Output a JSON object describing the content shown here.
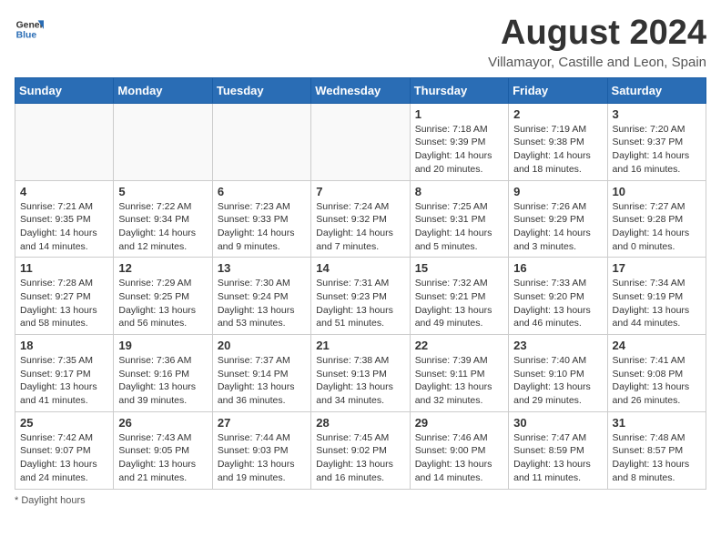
{
  "header": {
    "logo_line1": "General",
    "logo_line2": "Blue",
    "main_title": "August 2024",
    "subtitle": "Villamayor, Castille and Leon, Spain"
  },
  "days_of_week": [
    "Sunday",
    "Monday",
    "Tuesday",
    "Wednesday",
    "Thursday",
    "Friday",
    "Saturday"
  ],
  "weeks": [
    [
      {
        "day": "",
        "info": ""
      },
      {
        "day": "",
        "info": ""
      },
      {
        "day": "",
        "info": ""
      },
      {
        "day": "",
        "info": ""
      },
      {
        "day": "1",
        "info": "Sunrise: 7:18 AM\nSunset: 9:39 PM\nDaylight: 14 hours and 20 minutes."
      },
      {
        "day": "2",
        "info": "Sunrise: 7:19 AM\nSunset: 9:38 PM\nDaylight: 14 hours and 18 minutes."
      },
      {
        "day": "3",
        "info": "Sunrise: 7:20 AM\nSunset: 9:37 PM\nDaylight: 14 hours and 16 minutes."
      }
    ],
    [
      {
        "day": "4",
        "info": "Sunrise: 7:21 AM\nSunset: 9:35 PM\nDaylight: 14 hours and 14 minutes."
      },
      {
        "day": "5",
        "info": "Sunrise: 7:22 AM\nSunset: 9:34 PM\nDaylight: 14 hours and 12 minutes."
      },
      {
        "day": "6",
        "info": "Sunrise: 7:23 AM\nSunset: 9:33 PM\nDaylight: 14 hours and 9 minutes."
      },
      {
        "day": "7",
        "info": "Sunrise: 7:24 AM\nSunset: 9:32 PM\nDaylight: 14 hours and 7 minutes."
      },
      {
        "day": "8",
        "info": "Sunrise: 7:25 AM\nSunset: 9:31 PM\nDaylight: 14 hours and 5 minutes."
      },
      {
        "day": "9",
        "info": "Sunrise: 7:26 AM\nSunset: 9:29 PM\nDaylight: 14 hours and 3 minutes."
      },
      {
        "day": "10",
        "info": "Sunrise: 7:27 AM\nSunset: 9:28 PM\nDaylight: 14 hours and 0 minutes."
      }
    ],
    [
      {
        "day": "11",
        "info": "Sunrise: 7:28 AM\nSunset: 9:27 PM\nDaylight: 13 hours and 58 minutes."
      },
      {
        "day": "12",
        "info": "Sunrise: 7:29 AM\nSunset: 9:25 PM\nDaylight: 13 hours and 56 minutes."
      },
      {
        "day": "13",
        "info": "Sunrise: 7:30 AM\nSunset: 9:24 PM\nDaylight: 13 hours and 53 minutes."
      },
      {
        "day": "14",
        "info": "Sunrise: 7:31 AM\nSunset: 9:23 PM\nDaylight: 13 hours and 51 minutes."
      },
      {
        "day": "15",
        "info": "Sunrise: 7:32 AM\nSunset: 9:21 PM\nDaylight: 13 hours and 49 minutes."
      },
      {
        "day": "16",
        "info": "Sunrise: 7:33 AM\nSunset: 9:20 PM\nDaylight: 13 hours and 46 minutes."
      },
      {
        "day": "17",
        "info": "Sunrise: 7:34 AM\nSunset: 9:19 PM\nDaylight: 13 hours and 44 minutes."
      }
    ],
    [
      {
        "day": "18",
        "info": "Sunrise: 7:35 AM\nSunset: 9:17 PM\nDaylight: 13 hours and 41 minutes."
      },
      {
        "day": "19",
        "info": "Sunrise: 7:36 AM\nSunset: 9:16 PM\nDaylight: 13 hours and 39 minutes."
      },
      {
        "day": "20",
        "info": "Sunrise: 7:37 AM\nSunset: 9:14 PM\nDaylight: 13 hours and 36 minutes."
      },
      {
        "day": "21",
        "info": "Sunrise: 7:38 AM\nSunset: 9:13 PM\nDaylight: 13 hours and 34 minutes."
      },
      {
        "day": "22",
        "info": "Sunrise: 7:39 AM\nSunset: 9:11 PM\nDaylight: 13 hours and 32 minutes."
      },
      {
        "day": "23",
        "info": "Sunrise: 7:40 AM\nSunset: 9:10 PM\nDaylight: 13 hours and 29 minutes."
      },
      {
        "day": "24",
        "info": "Sunrise: 7:41 AM\nSunset: 9:08 PM\nDaylight: 13 hours and 26 minutes."
      }
    ],
    [
      {
        "day": "25",
        "info": "Sunrise: 7:42 AM\nSunset: 9:07 PM\nDaylight: 13 hours and 24 minutes."
      },
      {
        "day": "26",
        "info": "Sunrise: 7:43 AM\nSunset: 9:05 PM\nDaylight: 13 hours and 21 minutes."
      },
      {
        "day": "27",
        "info": "Sunrise: 7:44 AM\nSunset: 9:03 PM\nDaylight: 13 hours and 19 minutes."
      },
      {
        "day": "28",
        "info": "Sunrise: 7:45 AM\nSunset: 9:02 PM\nDaylight: 13 hours and 16 minutes."
      },
      {
        "day": "29",
        "info": "Sunrise: 7:46 AM\nSunset: 9:00 PM\nDaylight: 13 hours and 14 minutes."
      },
      {
        "day": "30",
        "info": "Sunrise: 7:47 AM\nSunset: 8:59 PM\nDaylight: 13 hours and 11 minutes."
      },
      {
        "day": "31",
        "info": "Sunrise: 7:48 AM\nSunset: 8:57 PM\nDaylight: 13 hours and 8 minutes."
      }
    ]
  ],
  "footer": {
    "note": "Daylight hours"
  }
}
